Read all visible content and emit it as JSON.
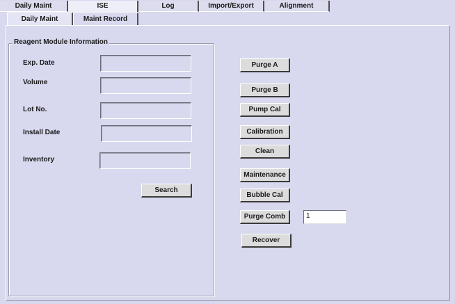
{
  "top_tabs": [
    "Daily Maint",
    "ISE",
    "Log",
    "Import/Export",
    "Alignment"
  ],
  "sub_tabs": [
    "Daily Maint",
    "Maint Record"
  ],
  "reagent": {
    "title": "Reagent Module Information",
    "fields": [
      {
        "label": "Exp. Date",
        "value": ""
      },
      {
        "label": "Volume",
        "value": ""
      },
      {
        "label": "Lot No.",
        "value": ""
      },
      {
        "label": "Install Date",
        "value": ""
      },
      {
        "label": "Inventory",
        "value": ""
      }
    ],
    "search_label": "Search"
  },
  "actions": {
    "purge_a": "Purge A",
    "purge_b": "Purge B",
    "pump_cal": "Pump Cal",
    "calibration": "Calibration",
    "clean": "Clean",
    "maintenance": "Maintenance",
    "bubble_cal": "Bubble Cal",
    "purge_comb": "Purge Comb",
    "purge_comb_value": "1",
    "recover": "Recover"
  }
}
